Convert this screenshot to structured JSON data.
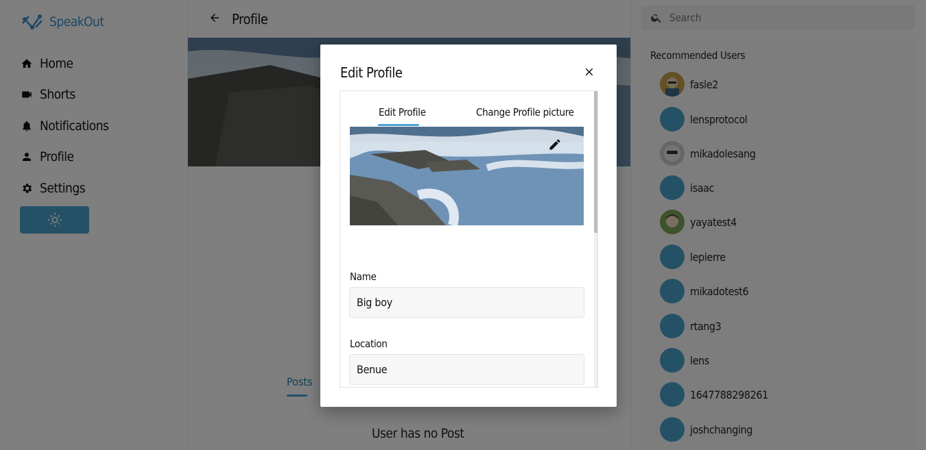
{
  "app": {
    "name": "SpeakOut"
  },
  "sidebar": {
    "items": [
      {
        "label": "Home",
        "icon": "home-icon"
      },
      {
        "label": "Shorts",
        "icon": "video-camera-icon"
      },
      {
        "label": "Notifications",
        "icon": "bell-icon"
      },
      {
        "label": "Profile",
        "icon": "person-icon"
      },
      {
        "label": "Settings",
        "icon": "gear-icon"
      }
    ],
    "theme_toggle_icon": "sun-icon"
  },
  "header": {
    "title": "Profile",
    "back_icon": "arrow-left-icon"
  },
  "profile": {
    "posts_tab": "Posts",
    "empty_message": "User has no Post"
  },
  "search": {
    "placeholder": "Search"
  },
  "recommended": {
    "title": "Recommended Users",
    "users": [
      {
        "name": "fasle2"
      },
      {
        "name": "lensprotocol"
      },
      {
        "name": "mikadolesang"
      },
      {
        "name": "isaac"
      },
      {
        "name": "yayatest4"
      },
      {
        "name": "lepierre"
      },
      {
        "name": "mikadotest6"
      },
      {
        "name": "rtang3"
      },
      {
        "name": "lens"
      },
      {
        "name": "1647788298261"
      },
      {
        "name": "joshchanging"
      }
    ]
  },
  "modal": {
    "title": "Edit Profile",
    "tabs": [
      "Edit Profile",
      "Change Profile picture"
    ],
    "name_label": "Name",
    "name_value": "Big boy",
    "location_label": "Location",
    "location_value": "Benue"
  },
  "colors": {
    "accent": "#4aa3cf",
    "brand": "#3a8fc6"
  }
}
